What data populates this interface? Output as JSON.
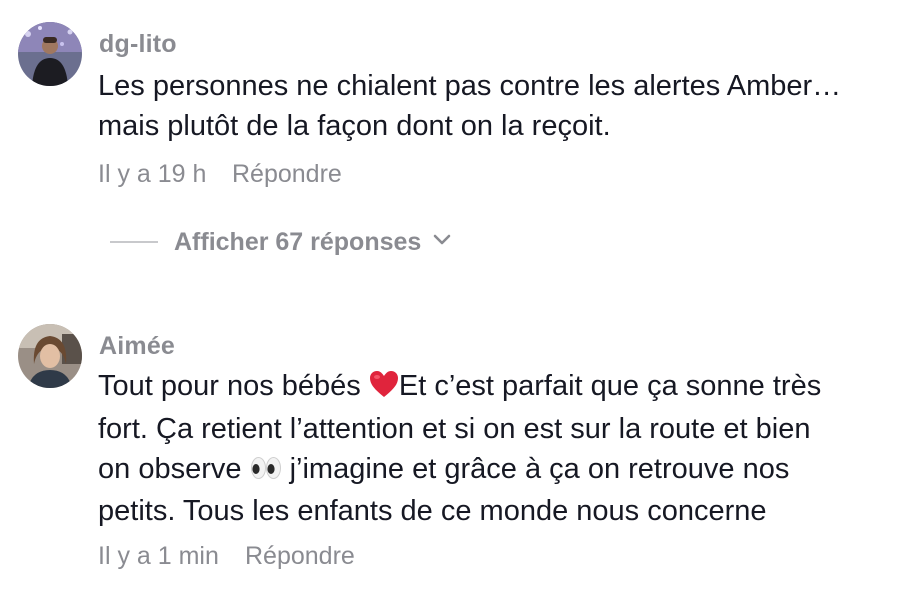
{
  "comments": [
    {
      "author": "dg-lito",
      "lines": [
        "Les personnes ne chialent pas contre les alertes Amber…",
        "mais plutôt de la façon dont on la reçoit."
      ],
      "time": "Il y a 19 h",
      "reply_label": "Répondre",
      "view_replies_label": "Afficher 67 réponses"
    },
    {
      "author": "Aimée",
      "line1_pre": "Tout pour nos bébés ",
      "line1_post": "Et c’est parfait que ça sonne très",
      "line2": "fort. Ça retient l’attention et si on est sur la route et bien",
      "line3_pre": "on observe ",
      "line3_post": " j’imagine et grâce à ça on retrouve nos",
      "line4": "petits. Tous les enfants de ce monde nous concerne",
      "emojis": [
        "red-heart-icon",
        "eyes-icon"
      ],
      "time": "Il y a 1 min",
      "reply_label": "Répondre"
    }
  ],
  "colors": {
    "text": "#161823",
    "secondary": "#8a8b91",
    "heart": "#e0243c"
  }
}
